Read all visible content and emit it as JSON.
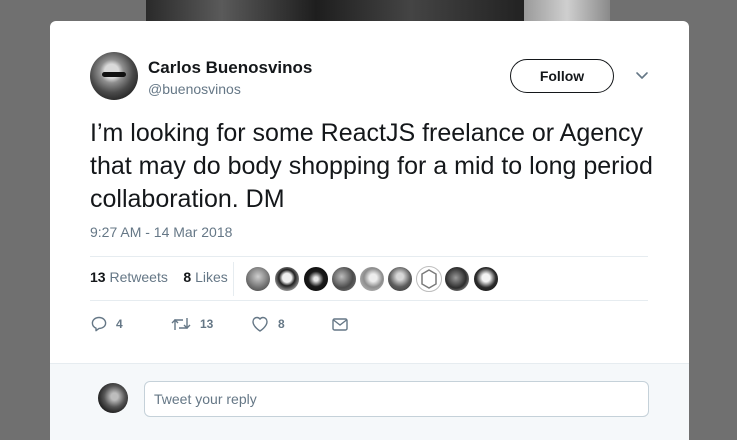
{
  "author": {
    "name": "Carlos Buenosvinos",
    "handle": "@buenosvinos"
  },
  "header": {
    "follow_label": "Follow"
  },
  "tweet": {
    "text": "I’m looking for some ReactJS freelance or Agency that may do body shopping for a mid to long period collaboration. DM",
    "timestamp": "9:27 AM - 14 Mar 2018"
  },
  "stats": {
    "retweets_count": "13",
    "retweets_label": "Retweets",
    "likes_count": "8",
    "likes_label": "Likes"
  },
  "actions": {
    "reply_count": "4",
    "retweet_count": "13",
    "like_count": "8"
  },
  "reply": {
    "placeholder": "Tweet your reply"
  },
  "colors": {
    "text_primary": "#14171a",
    "text_secondary": "#657786",
    "divider": "#e6ecf0",
    "reply_bar_bg": "#f5f8fa"
  }
}
